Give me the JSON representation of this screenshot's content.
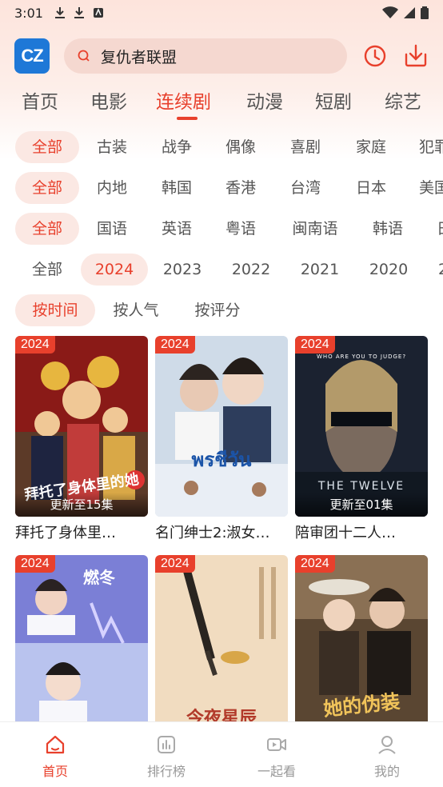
{
  "status": {
    "time": "3:01"
  },
  "app": {
    "logo_text": "CZ"
  },
  "search": {
    "value": "复仇者联盟"
  },
  "tabs": [
    "首页",
    "电影",
    "连续剧",
    "动漫",
    "短剧",
    "综艺"
  ],
  "active_tab": "连续剧",
  "filters": {
    "genre": [
      "全部",
      "古装",
      "战争",
      "偶像",
      "喜剧",
      "家庭",
      "犯罪"
    ],
    "region": [
      "全部",
      "内地",
      "韩国",
      "香港",
      "台湾",
      "日本",
      "美国"
    ],
    "language": [
      "全部",
      "国语",
      "英语",
      "粤语",
      "闽南语",
      "韩语",
      "日"
    ],
    "year": [
      "全部",
      "2024",
      "2023",
      "2022",
      "2021",
      "2020",
      "2"
    ],
    "sort": [
      "按时间",
      "按人气",
      "按评分"
    ]
  },
  "cards": [
    {
      "year": "2024",
      "title": "拜托了身体里…",
      "episode": "更新至15集",
      "poster_text": "拜托了身体里的她"
    },
    {
      "year": "2024",
      "title": "名门绅士2:淑女…",
      "episode": "",
      "poster_text": "พรชีวัน"
    },
    {
      "year": "2024",
      "title": "陪审团十二人…",
      "episode": "更新至01集",
      "poster_text": "THE TWELVE",
      "poster_sub": "WHO ARE YOU TO JUDGE?"
    },
    {
      "year": "2024",
      "title": "",
      "episode": "",
      "poster_text": "燃冬"
    },
    {
      "year": "2024",
      "title": "",
      "episode": "",
      "poster_text": "今夜星辰"
    },
    {
      "year": "2024",
      "title": "",
      "episode": "",
      "poster_text": "她的伪装"
    }
  ],
  "bottom_nav": [
    "首页",
    "排行榜",
    "一起看",
    "我的"
  ],
  "colors": {
    "accent": "#e8402c",
    "logo": "#1e78d7"
  }
}
